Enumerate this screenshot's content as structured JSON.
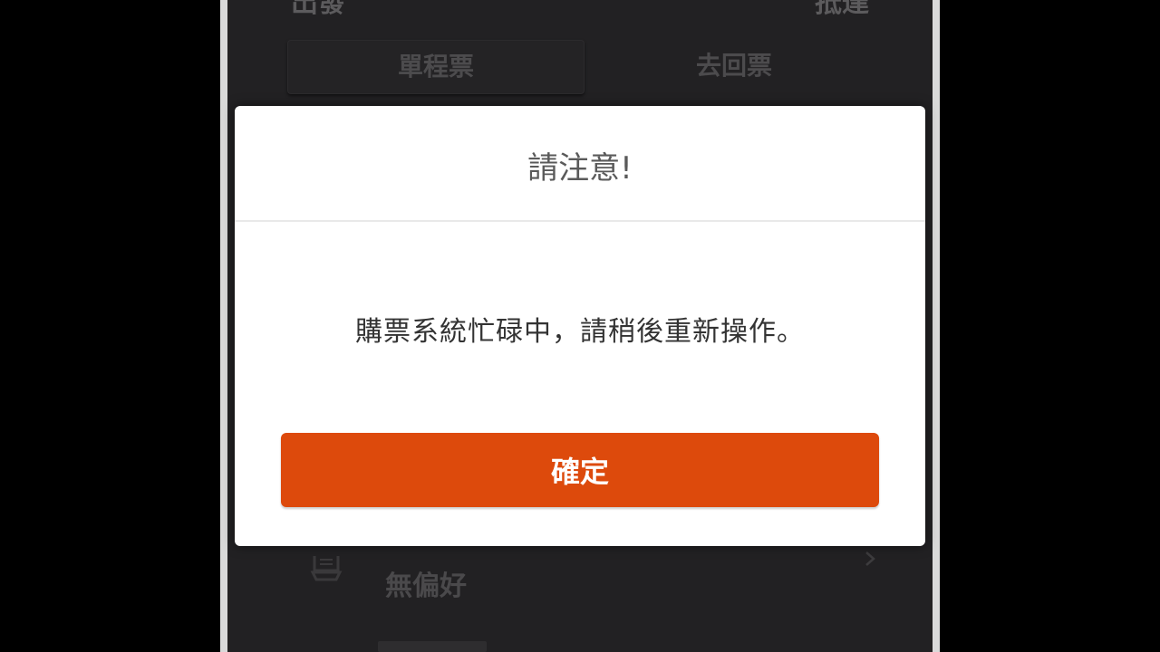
{
  "background": {
    "top_left_text": "出發",
    "top_right_text": "抵達",
    "trip_type_tabs": [
      {
        "label": "單程票",
        "selected": true
      },
      {
        "label": "去回票",
        "selected": false
      }
    ],
    "preference": {
      "icon": "seat-icon",
      "label": "無偏好",
      "chevron": "chevron-right-icon"
    }
  },
  "dialog": {
    "title": "請注意!",
    "message": "購票系統忙碌中，請稍後重新操作。",
    "confirm_label": "確定"
  },
  "colors": {
    "accent": "#dd4a0c",
    "overlay_background": "#222123",
    "dialog_background": "#ffffff"
  }
}
